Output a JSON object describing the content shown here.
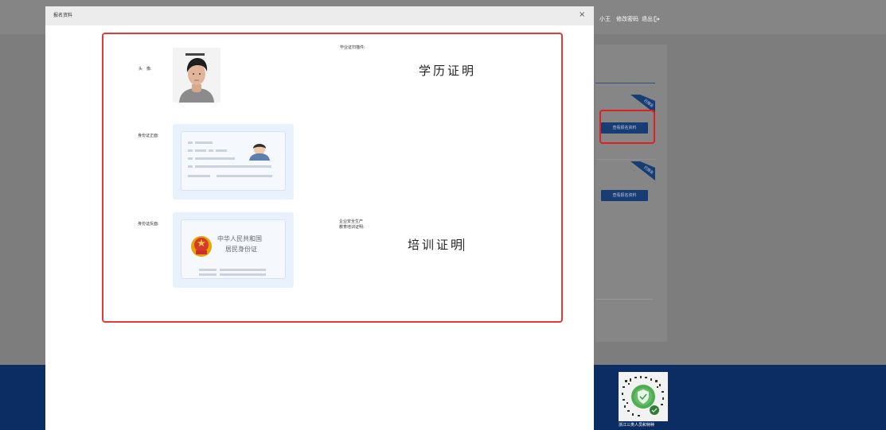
{
  "background_page": {
    "user_name": "小王",
    "change_password": "修改密码",
    "logout": "退出",
    "view_buttons": [
      "查看报名资料",
      "查看报名资料"
    ],
    "ribbon_labels": [
      "已报名",
      "已报名"
    ],
    "qr_caption": "浙江三类人员和特种"
  },
  "modal": {
    "title": "报名资料",
    "close_symbol": "×",
    "fields": {
      "avatar_label": "头　像:",
      "grad_cert_label": "毕业证扫描件:",
      "grad_cert_text": "学历证明",
      "id_front_label": "身份证正面:",
      "id_back_label": "身份证反面:",
      "training_label_line1": "企业安全生产",
      "training_label_line2": "教育培训证明:",
      "training_cert_text": "培训证明"
    },
    "id_back_card": {
      "line1": "中华人民共和国",
      "line2": "居民身份证"
    }
  },
  "colors": {
    "highlight_red": "#e53935",
    "footer_navy": "#0b2d63",
    "button_blue": "#173d74"
  }
}
